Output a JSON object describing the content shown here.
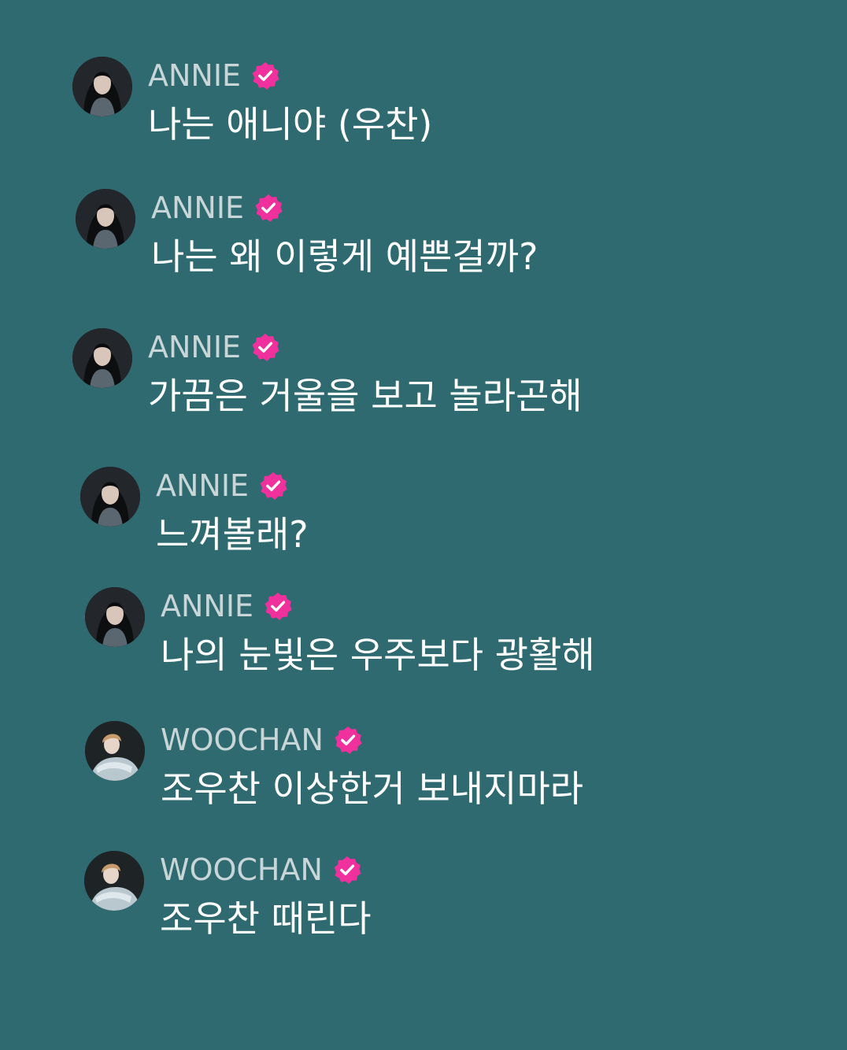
{
  "colors": {
    "background": "#2e6a70",
    "username": "#c9d6d8",
    "message_text": "#ffffff",
    "verified_badge": "#f0319d"
  },
  "messages": [
    {
      "user": "ANNIE",
      "verified": true,
      "avatar": "annie-avatar",
      "text": "나는 애니야 (우찬)"
    },
    {
      "user": "ANNIE",
      "verified": true,
      "avatar": "annie-avatar",
      "text": "나는 왜 이렇게 예쁜걸까?"
    },
    {
      "user": "ANNIE",
      "verified": true,
      "avatar": "annie-avatar",
      "text": "가끔은 거울을 보고 놀라곤해"
    },
    {
      "user": "ANNIE",
      "verified": true,
      "avatar": "annie-avatar",
      "text": "느껴볼래?"
    },
    {
      "user": "ANNIE",
      "verified": true,
      "avatar": "annie-avatar",
      "text": "나의 눈빛은 우주보다 광활해"
    },
    {
      "user": "WOOCHAN",
      "verified": true,
      "avatar": "woochan-avatar",
      "text": "조우찬 이상한거 보내지마라"
    },
    {
      "user": "WOOCHAN",
      "verified": true,
      "avatar": "woochan-avatar",
      "text": "조우찬 때린다"
    }
  ]
}
